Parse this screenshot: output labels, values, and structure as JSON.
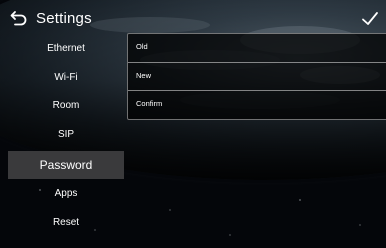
{
  "header": {
    "title": "Settings",
    "back_icon": "back-arrow-icon",
    "confirm_icon": "checkmark-icon"
  },
  "sidebar": {
    "items": [
      {
        "label": "Ethernet"
      },
      {
        "label": "Wi-Fi"
      },
      {
        "label": "Room"
      },
      {
        "label": "SIP"
      },
      {
        "label": "Password",
        "active": true
      },
      {
        "label": "Apps"
      },
      {
        "label": "Reset"
      }
    ]
  },
  "password_form": {
    "fields": [
      {
        "label": "Old",
        "value": ""
      },
      {
        "label": "New",
        "value": ""
      },
      {
        "label": "Confirm",
        "value": ""
      }
    ]
  },
  "colors": {
    "active_item_bg": "#3a3a3c",
    "text": "#ffffff",
    "panel_border": "#c8c8c8",
    "background": "#05070a"
  }
}
